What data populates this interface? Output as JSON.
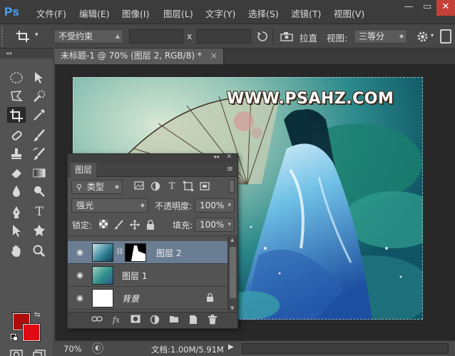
{
  "app": {
    "logo": "Ps",
    "menu": [
      "文件(F)",
      "编辑(E)",
      "图像(I)",
      "图层(L)",
      "文字(Y)",
      "选择(S)",
      "滤镜(T)",
      "视图(V)"
    ],
    "window_controls": {
      "minimize": "—",
      "restore": "▭",
      "close": "✕"
    }
  },
  "options": {
    "crop_icon": "crop-icon",
    "ratio_select": "不受约束",
    "times_symbol": "x",
    "straighten_label": "拉直",
    "view_label": "视图:",
    "view_select": "三等分"
  },
  "document": {
    "tab_title": "未标题-1 @ 70% (图层 2, RGB/8) *",
    "tab_close": "×",
    "watermark": "WWW.PSAHZ.COM"
  },
  "layers_panel": {
    "tab_label": "图层",
    "filter_select": "类型",
    "blend_mode": "强光",
    "opacity_label": "不透明度:",
    "opacity_value": "100%",
    "lock_label": "锁定:",
    "fill_label": "填充:",
    "fill_value": "100%",
    "layers": [
      {
        "name": "图层 2",
        "selected": true,
        "has_mask": true
      },
      {
        "name": "图层 1",
        "selected": false,
        "has_mask": false
      },
      {
        "name": "背景",
        "selected": false,
        "locked": true
      }
    ]
  },
  "status": {
    "zoom": "70%",
    "doc_size": "文档:1.00M/5.91M"
  },
  "colors": {
    "foreground": "#b00c0c",
    "background": "#e10a14",
    "accent": "#4aa3ff",
    "selected_layer": "#6b7d93"
  }
}
